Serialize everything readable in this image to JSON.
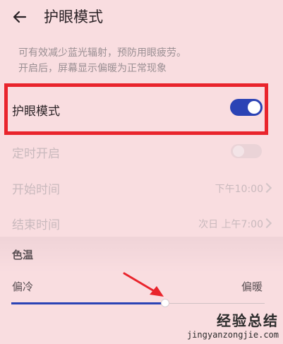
{
  "header": {
    "title": "护眼模式"
  },
  "description": {
    "line1": "可有效减少蓝光辐射，预防用眼疲劳。",
    "line2": "开启后，屏幕显示偏暖为正常现象"
  },
  "eye_protection": {
    "label": "护眼模式",
    "enabled": true,
    "accent": "#2b43b5"
  },
  "schedule": {
    "label": "定时开启",
    "enabled": false
  },
  "start_time": {
    "label": "开始时间",
    "value": "下午10:00"
  },
  "end_time": {
    "label": "结束时间",
    "value": "次日 上午7:00"
  },
  "color_temp": {
    "title": "色温",
    "cool_label": "偏冷",
    "warm_label": "偏暖",
    "level": 0.6
  },
  "annotation": {
    "highlight_color": "#e9242c",
    "arrow_color": "#e9242c"
  },
  "watermark": {
    "title": "经验总结",
    "url": "jingyanzongjie.com"
  }
}
